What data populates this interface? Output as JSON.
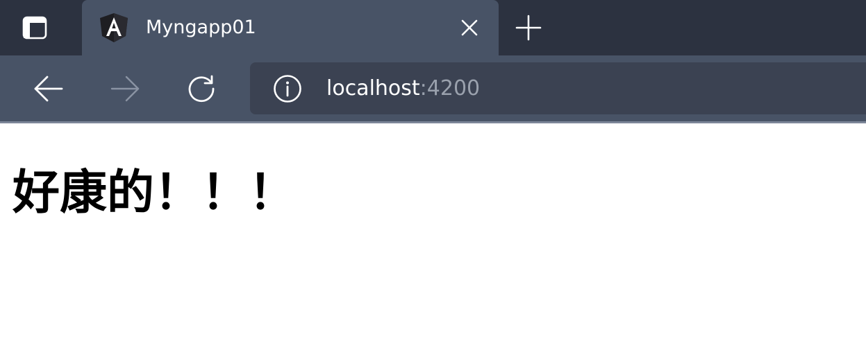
{
  "tab": {
    "title": "Myngapp01",
    "favicon": "angular-logo-icon"
  },
  "toolbar": {
    "address": {
      "host": "localhost",
      "port": ":4200"
    }
  },
  "page": {
    "heading": "好康的！！！"
  },
  "colors": {
    "tabstrip_bg": "#2c3240",
    "active_tab_bg": "#485366",
    "toolbar_bg": "#485366",
    "omnibox_bg": "#3b4252",
    "url_host": "#ffffff",
    "url_port": "#9aa1ad",
    "forward_disabled": "#8a93a3"
  }
}
